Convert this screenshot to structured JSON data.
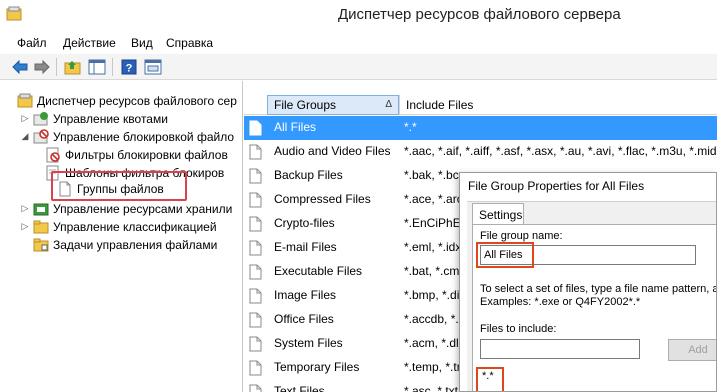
{
  "window": {
    "title": "Диспетчер ресурсов файлового сервера"
  },
  "menu": {
    "items": [
      "Файл",
      "Действие",
      "Вид",
      "Справка"
    ]
  },
  "toolbar": {
    "icons": [
      "back-icon",
      "forward-icon",
      "up-folder-icon",
      "show-hide-tree-icon",
      "help-icon",
      "properties-icon"
    ]
  },
  "tree": {
    "items": [
      {
        "label": "Диспетчер ресурсов файлового сер",
        "icon": "fsrm-icon"
      },
      {
        "label": "Управление квотами",
        "icon": "quota-icon"
      },
      {
        "label": "Управление блокировкой файло",
        "icon": "block-icon"
      },
      {
        "label": "Фильтры блокировки файлов",
        "icon": "filter-icon"
      },
      {
        "label": "Шаблоны фильтра блокиров",
        "icon": "template-icon"
      },
      {
        "label": "Группы файлов",
        "icon": "file-group-icon"
      },
      {
        "label": "Управление ресурсами хранили",
        "icon": "storage-icon"
      },
      {
        "label": "Управление классификацией",
        "icon": "classification-icon"
      },
      {
        "label": "Задачи управления файлами",
        "icon": "tasks-icon"
      }
    ]
  },
  "list": {
    "columns": [
      "File Groups",
      "Include Files"
    ],
    "sort_indicator": "Δ",
    "rows": [
      {
        "name": "All Files",
        "include": "*.*"
      },
      {
        "name": "Audio and Video Files",
        "include": "*.aac, *.aif, *.aiff, *.asf, *.asx, *.au, *.avi, *.flac, *.m3u, *.mid, *.mi"
      },
      {
        "name": "Backup Files",
        "include": "*.bak, *.bc"
      },
      {
        "name": "Compressed Files",
        "include": "*.ace, *.arc"
      },
      {
        "name": "Crypto-files",
        "include": "*.EnCiPhEr"
      },
      {
        "name": "E-mail Files",
        "include": "*.eml, *.idx"
      },
      {
        "name": "Executable Files",
        "include": "*.bat, *.cmd"
      },
      {
        "name": "Image Files",
        "include": "*.bmp, *.dib"
      },
      {
        "name": "Office Files",
        "include": "*.accdb, *.a"
      },
      {
        "name": "System Files",
        "include": "*.acm, *.dll"
      },
      {
        "name": "Temporary Files",
        "include": "*.temp, *.tm"
      },
      {
        "name": "Text Files",
        "include": "*.asc, *.txt"
      }
    ]
  },
  "dialog": {
    "title": "File Group Properties for All Files",
    "tab": "Settings",
    "name_label": "File group name:",
    "name_value": "All Files",
    "hint_line1": "To select a set of files, type a file name pattern, and",
    "hint_line2": "Examples: *.exe or Q4FY2002*.*",
    "include_label": "Files to include:",
    "include_value": "",
    "add_button": "Add",
    "include_list_item": "*.*"
  },
  "colors": {
    "selection": "#3399ff",
    "highlight_red": "#d9434a",
    "dialog_outline_orange": "#e0461c"
  }
}
